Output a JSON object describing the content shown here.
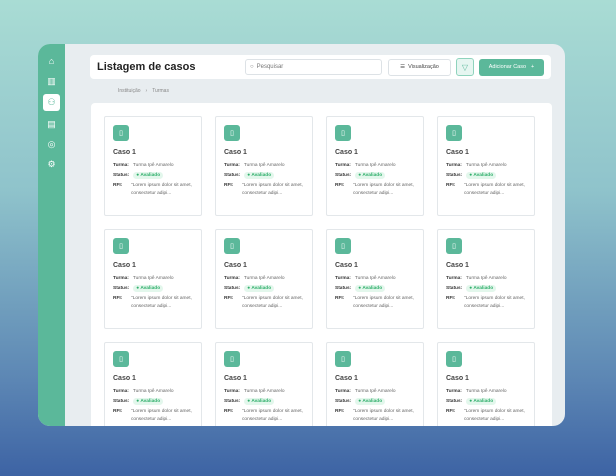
{
  "header": {
    "title": "Listagem de casos",
    "search_placeholder": "Pesquisar",
    "view_label": "Visualização",
    "add_label": "Adicionar Caso",
    "add_icon": "+"
  },
  "breadcrumb": [
    "Instituição",
    "Turmas"
  ],
  "sidebar": [
    "home-icon",
    "chart-icon",
    "users-icon",
    "document-icon",
    "circle-icon",
    "gear-icon"
  ],
  "labels": {
    "turma": "Turma:",
    "status": "Status:",
    "rfi": "RFI:"
  },
  "cards": [
    {
      "title": "Caso 1",
      "turma": "Turma Ipê Amarelo",
      "status": "● Avaliado",
      "rfi": "\"Lorem ipsum dolor sit amet, consectetur adipi..."
    }
  ],
  "card_count": 12,
  "colors": {
    "accent": "#5bb89a"
  }
}
